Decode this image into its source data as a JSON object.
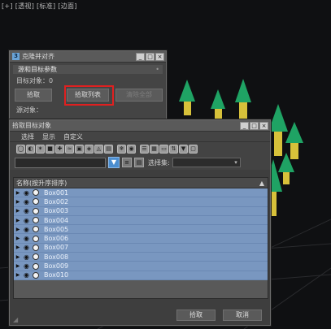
{
  "viewport": {
    "label": "[+] [透视] [标准] [边面]"
  },
  "clone_dialog": {
    "title": "克隆并对齐",
    "icon_letter": "3",
    "title_buttons": [
      "_",
      "□",
      "×"
    ],
    "rollout_title": "源和目标参数",
    "rollout_marker": "•",
    "target_count_label": "目标对象：0",
    "pick_button": "拾取",
    "pick_list_button": "拾取列表",
    "clear_all_button": "清除全部",
    "source_label": "源对象："
  },
  "pick_dialog": {
    "title": "拾取目标对象",
    "title_buttons": [
      "_",
      "□",
      "×"
    ],
    "menu": [
      "选择",
      "显示",
      "自定义"
    ],
    "selection_set_label": "选择集:",
    "list_header": "名称(按升序排序)",
    "sort_glyph": "▲",
    "rows": [
      "Box001",
      "Box002",
      "Box003",
      "Box004",
      "Box005",
      "Box006",
      "Box007",
      "Box008",
      "Box009",
      "Box010"
    ],
    "ok_button": "拾取",
    "cancel_button": "取消"
  },
  "colors": {
    "highlight_red": "#e02020",
    "row_blue": "#7997c0",
    "tree_green": "#1fa364",
    "trunk_yellow": "#d7c13a"
  }
}
